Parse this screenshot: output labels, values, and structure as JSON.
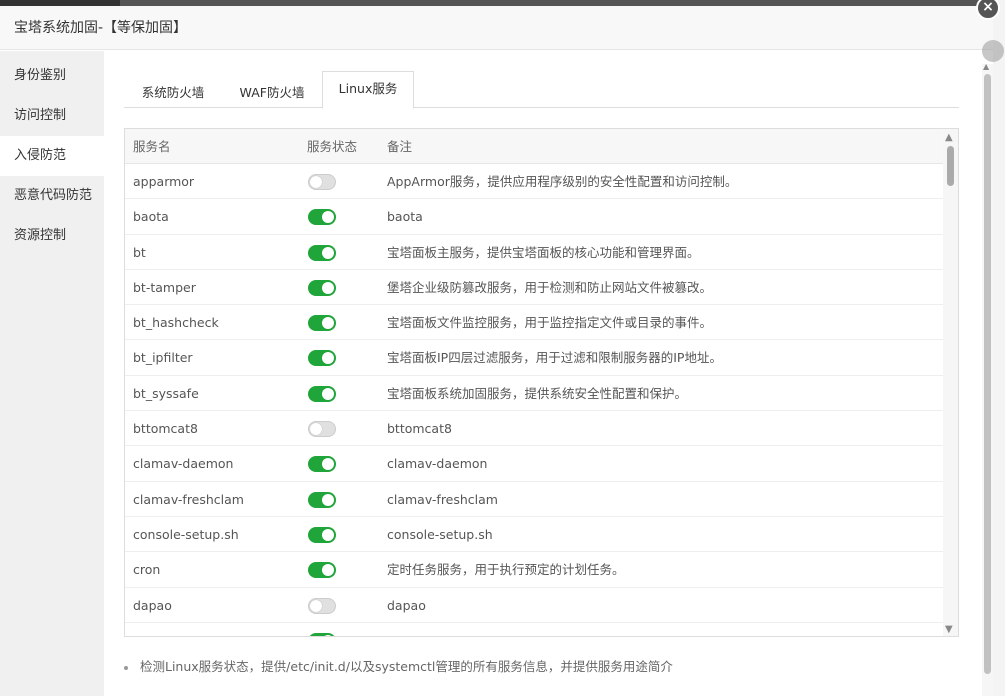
{
  "dialog": {
    "title": "宝塔系统加固-【等保加固】",
    "close_icon": "×"
  },
  "sidebar": {
    "items": [
      {
        "label": "身份鉴别",
        "active": false
      },
      {
        "label": "访问控制",
        "active": false
      },
      {
        "label": "入侵防范",
        "active": true
      },
      {
        "label": "恶意代码防范",
        "active": false
      },
      {
        "label": "资源控制",
        "active": false
      }
    ]
  },
  "tabs": [
    {
      "label": "系统防火墙",
      "active": false
    },
    {
      "label": "WAF防火墙",
      "active": false
    },
    {
      "label": "Linux服务",
      "active": true
    }
  ],
  "table": {
    "columns": [
      "服务名",
      "服务状态",
      "备注"
    ],
    "rows": [
      {
        "name": "apparmor",
        "enabled": false,
        "note": "AppArmor服务，提供应用程序级别的安全性配置和访问控制。"
      },
      {
        "name": "baota",
        "enabled": true,
        "note": "baota"
      },
      {
        "name": "bt",
        "enabled": true,
        "note": "宝塔面板主服务，提供宝塔面板的核心功能和管理界面。"
      },
      {
        "name": "bt-tamper",
        "enabled": true,
        "note": "堡塔企业级防篡改服务，用于检测和防止网站文件被篡改。"
      },
      {
        "name": "bt_hashcheck",
        "enabled": true,
        "note": "宝塔面板文件监控服务，用于监控指定文件或目录的事件。"
      },
      {
        "name": "bt_ipfilter",
        "enabled": true,
        "note": "宝塔面板IP四层过滤服务，用于过滤和限制服务器的IP地址。"
      },
      {
        "name": "bt_syssafe",
        "enabled": true,
        "note": "宝塔面板系统加固服务，提供系统安全性配置和保护。"
      },
      {
        "name": "bttomcat8",
        "enabled": false,
        "note": "bttomcat8"
      },
      {
        "name": "clamav-daemon",
        "enabled": true,
        "note": "clamav-daemon"
      },
      {
        "name": "clamav-freshclam",
        "enabled": true,
        "note": "clamav-freshclam"
      },
      {
        "name": "console-setup.sh",
        "enabled": true,
        "note": "console-setup.sh"
      },
      {
        "name": "cron",
        "enabled": true,
        "note": "定时任务服务，用于执行预定的计划任务。"
      },
      {
        "name": "dapao",
        "enabled": false,
        "note": "dapao"
      },
      {
        "name": "",
        "enabled": true,
        "note": ""
      }
    ]
  },
  "help_text": "检测Linux服务状态，提供/etc/init.d/以及systemctl管理的所有服务信息，并提供服务用途简介",
  "colors": {
    "accent": "#20a53a",
    "toggle_off": "#e0e0e0"
  },
  "icons": {
    "scroll_up": "▲",
    "scroll_down": "▼"
  }
}
